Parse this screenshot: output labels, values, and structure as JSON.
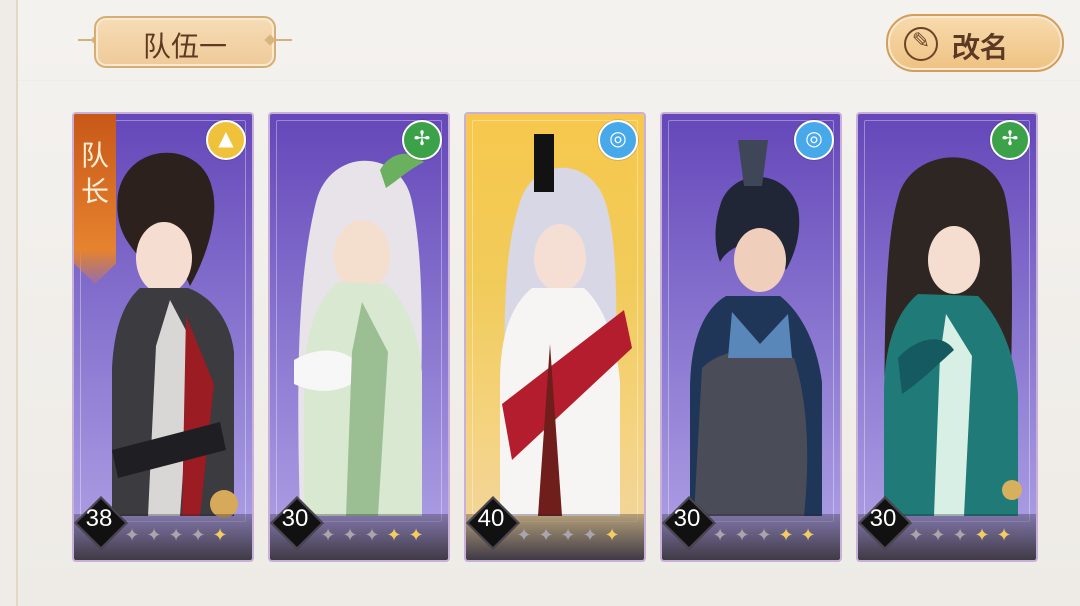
{
  "team": {
    "title": "队伍一",
    "rename_label": "改名"
  },
  "cards": [
    {
      "level": "38",
      "leader_label": "队长",
      "element_icon": "earth-icon",
      "stars": [
        1,
        1,
        1,
        1,
        1
      ]
    },
    {
      "level": "30",
      "element_icon": "wind-icon",
      "stars": [
        1,
        1,
        1,
        1,
        1
      ]
    },
    {
      "level": "40",
      "element_icon": "water-icon",
      "stars": [
        1,
        1,
        1,
        1,
        1
      ]
    },
    {
      "level": "30",
      "element_icon": "water-icon",
      "stars": [
        1,
        1,
        1,
        1,
        1
      ]
    },
    {
      "level": "30",
      "element_icon": "wind-icon",
      "stars": [
        1,
        1,
        1,
        1,
        1
      ]
    }
  ]
}
